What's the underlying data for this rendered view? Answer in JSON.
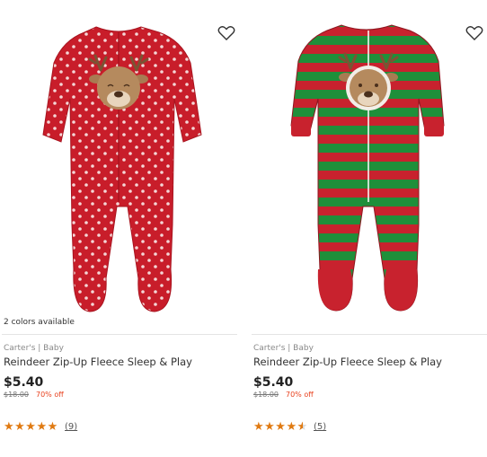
{
  "products": [
    {
      "colors_available": "2 colors available",
      "brand": "Carter's | Baby",
      "title": "Reindeer Zip-Up Fleece Sleep & Play",
      "price": "$5.40",
      "was_price": "$18.00",
      "discount": "70% off",
      "rating": 5,
      "review_count": "(9)",
      "wishlist_icon": "heart-outline-icon",
      "colors": {
        "body": "#c81d2a",
        "dots": "#f4d6d6",
        "face": "#b58a5e"
      }
    },
    {
      "brand": "Carter's | Baby",
      "title": "Reindeer Zip-Up Fleece Sleep & Play",
      "price": "$5.40",
      "was_price": "$18.00",
      "discount": "70% off",
      "rating": 4.5,
      "review_count": "(5)",
      "wishlist_icon": "heart-outline-icon",
      "colors": {
        "stripe_red": "#c8222e",
        "stripe_green": "#1f8f3a",
        "face": "#b58a5e"
      }
    }
  ],
  "colors": {
    "price": "#222222",
    "discount": "#e8411e",
    "stars": "#e07a12"
  }
}
